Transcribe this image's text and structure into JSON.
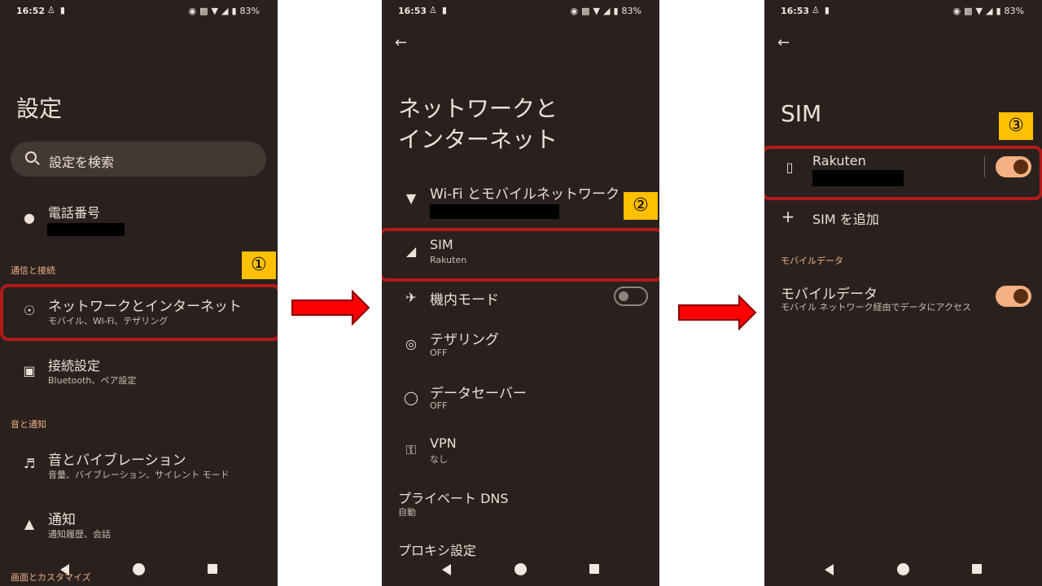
{
  "panel1": {
    "status": {
      "time": "16:52",
      "battery": "83%"
    },
    "title": "設定",
    "search_placeholder": "設定を検索",
    "phone_label": "電話番号",
    "section_connect": "通信と接続",
    "network": {
      "title": "ネットワークとインターネット",
      "sub": "モバイル、Wi-Fi、テザリング"
    },
    "connection": {
      "title": "接続設定",
      "sub": "Bluetooth、ペア設定"
    },
    "section_sound": "音と通知",
    "sound": {
      "title": "音とバイブレーション",
      "sub": "音量、バイブレーション、サイレント モード"
    },
    "notify": {
      "title": "通知",
      "sub": "通知履歴、会話"
    },
    "section_display": "画面とカスタマイズ",
    "badge": "①"
  },
  "panel2": {
    "status": {
      "time": "16:53",
      "battery": "83%"
    },
    "title_line1": "ネットワークと",
    "title_line2": "インターネット",
    "wifi": {
      "title": "Wi-Fi とモバイルネットワーク"
    },
    "sim": {
      "title": "SIM",
      "sub": "Rakuten"
    },
    "airplane": {
      "title": "機内モード"
    },
    "tethering": {
      "title": "テザリング",
      "sub": "OFF"
    },
    "datasaver": {
      "title": "データセーバー",
      "sub": "OFF"
    },
    "vpn": {
      "title": "VPN",
      "sub": "なし"
    },
    "dns": {
      "title": "プライベート DNS",
      "sub": "自動"
    },
    "proxy": {
      "title": "プロキシ設定"
    },
    "badge": "②"
  },
  "panel3": {
    "status": {
      "time": "16:53",
      "battery": "83%"
    },
    "title": "SIM",
    "rakuten": {
      "title": "Rakuten"
    },
    "add_sim": "SIM を追加",
    "section_mobile": "モバイルデータ",
    "mobile": {
      "title": "モバイルデータ",
      "sub": "モバイル ネットワーク経由でデータにアクセス"
    },
    "badge": "③"
  },
  "colors": {
    "background": "#2a211e",
    "highlight": "#b21a1a",
    "badge": "#ffc000",
    "arrow": "#ff0000",
    "accent": "#f0b08a"
  }
}
